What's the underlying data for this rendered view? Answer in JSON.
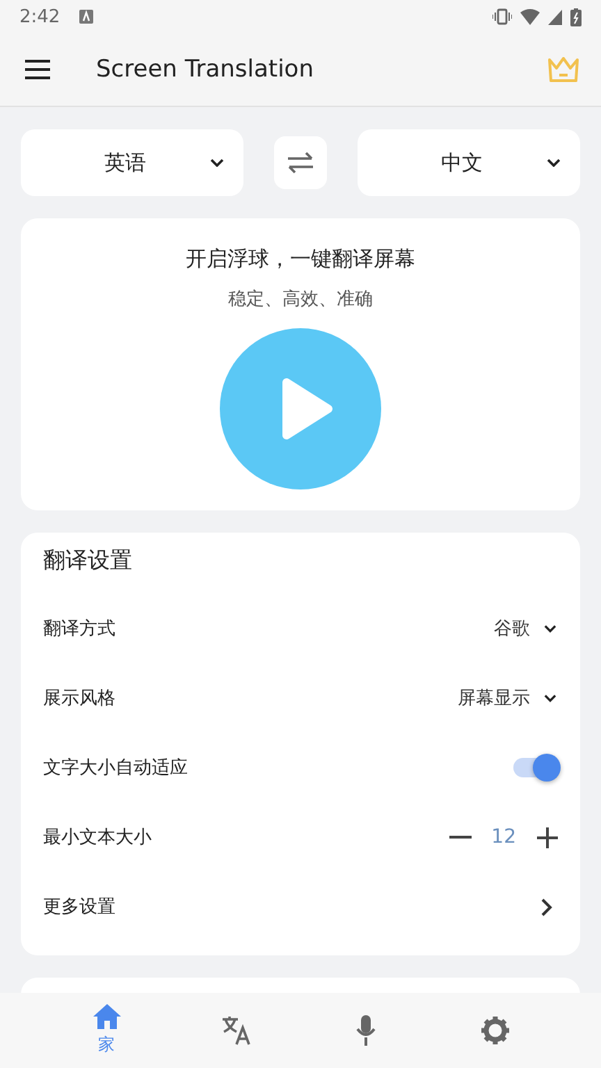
{
  "status_bar": {
    "time": "2:42"
  },
  "app_bar": {
    "title": "Screen Translation"
  },
  "languages": {
    "source": "英语",
    "target": "中文"
  },
  "hero": {
    "title": "开启浮球，一键翻译屏幕",
    "subtitle": "稳定、高效、准确"
  },
  "settings": {
    "title": "翻译设置",
    "rows": [
      {
        "kind": "dropdown",
        "label": "翻译方式",
        "value": "谷歌"
      },
      {
        "kind": "dropdown",
        "label": "展示风格",
        "value": "屏幕显示"
      },
      {
        "kind": "toggle",
        "label": "文字大小自动适应",
        "on": true
      },
      {
        "kind": "stepper",
        "label": "最小文本大小",
        "value": "12"
      },
      {
        "kind": "link",
        "label": "更多设置"
      }
    ]
  },
  "bottom_nav": [
    {
      "label": "家",
      "selected": true
    },
    {
      "selected": false
    },
    {
      "selected": false
    },
    {
      "selected": false
    }
  ]
}
